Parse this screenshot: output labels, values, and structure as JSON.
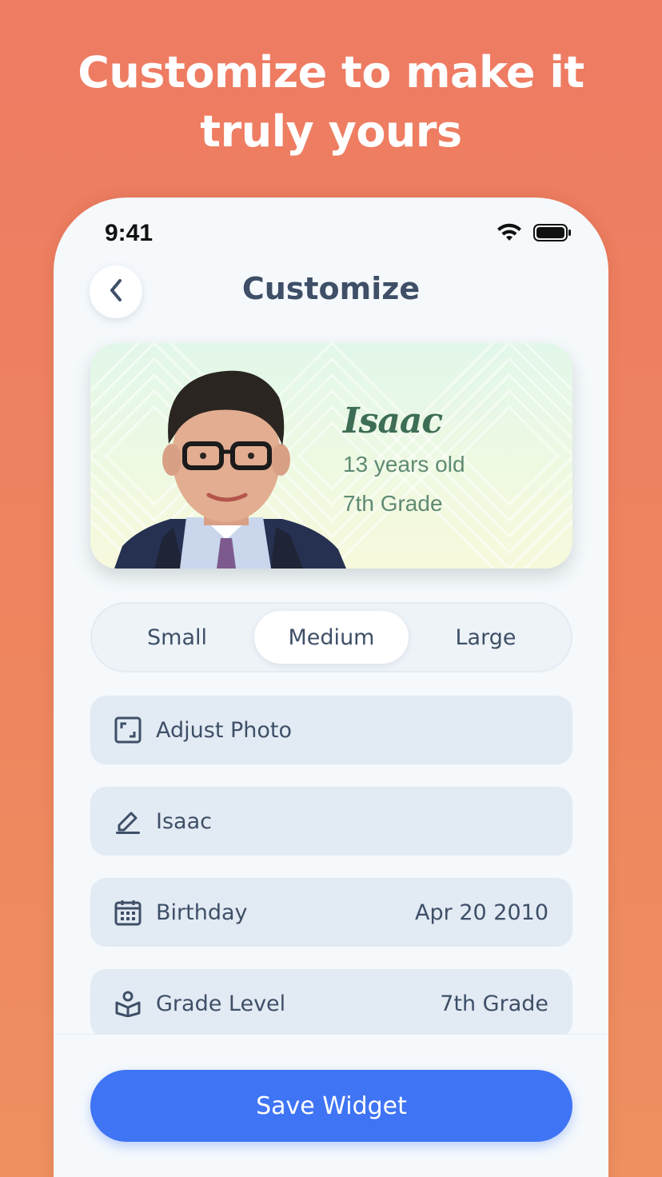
{
  "headline": {
    "line1": "Customize to make it",
    "line2": "truly yours"
  },
  "status_bar": {
    "time": "9:41",
    "wifi_icon": "wifi-icon",
    "battery_icon": "battery-icon"
  },
  "nav": {
    "back_icon": "chevron-left-icon",
    "title": "Customize"
  },
  "preview": {
    "name": "Isaac",
    "age": "13 years old",
    "grade": "7th Grade"
  },
  "size_options": {
    "items": [
      "Small",
      "Medium",
      "Large"
    ],
    "selected": "Medium"
  },
  "settings": {
    "adjust_photo": {
      "label": "Adjust Photo",
      "icon": "crop-icon"
    },
    "name": {
      "label": "Isaac",
      "icon": "pencil-icon"
    },
    "birthday": {
      "label": "Birthday",
      "value": "Apr 20 2010",
      "icon": "calendar-icon"
    },
    "grade_level": {
      "label": "Grade Level",
      "value": "7th Grade",
      "icon": "book-reader-icon"
    }
  },
  "save_button": {
    "label": "Save Widget"
  },
  "colors": {
    "background": "#ee845f",
    "accent": "#3f74f4",
    "text": "#3e4f67",
    "card_name": "#3d6e55"
  }
}
